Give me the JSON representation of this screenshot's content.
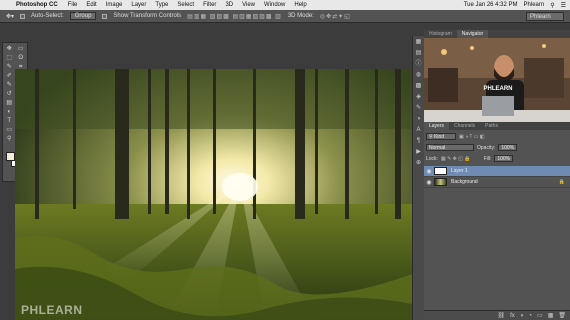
{
  "menubar": {
    "apple": "",
    "app_name": "Photoshop CC",
    "items": [
      "File",
      "Edit",
      "Image",
      "Layer",
      "Type",
      "Select",
      "Filter",
      "3D",
      "View",
      "Window",
      "Help"
    ],
    "datetime": "Tue Jan 26  4:32 PM",
    "user": "Phlearn"
  },
  "options_bar": {
    "auto_select_label": "Auto-Select:",
    "auto_select_value": "Group",
    "transform_label": "Show Transform Controls",
    "mode_label": "3D Mode:",
    "workspace": "Phlearn"
  },
  "toolbar": {
    "tools": [
      "move-tool",
      "artboard-tool",
      "marquee-tool",
      "lasso-tool",
      "quick-select-tool",
      "crop-tool",
      "eyedropper-tool",
      "healing-tool",
      "brush-tool",
      "clone-tool",
      "history-brush-tool",
      "eraser-tool",
      "gradient-tool",
      "blur-tool",
      "dodge-tool",
      "pen-tool",
      "type-tool",
      "path-select-tool",
      "shape-tool",
      "hand-tool",
      "zoom-tool"
    ],
    "glyphs": [
      "✥",
      "▭",
      "⬚",
      "ʘ",
      "✎",
      "⌗",
      "✐",
      "✚",
      "✎",
      "⛁",
      "↺",
      "◻",
      "▤",
      "◉",
      "◐",
      "✒",
      "T",
      "➤",
      "▭",
      "✋",
      "⚲"
    ]
  },
  "navigator": {
    "tabs": [
      "Histogram",
      "Navigator"
    ],
    "active_tab": "Navigator",
    "laptop_text": "PHLEARN"
  },
  "layers": {
    "tabs": [
      "Layers",
      "Channels",
      "Paths"
    ],
    "kind_label": "Kind",
    "blend_mode": "Normal",
    "opacity_label": "Opacity:",
    "opacity_value": "100%",
    "lock_label": "Lock:",
    "fill_label": "Fill:",
    "fill_value": "100%",
    "items": [
      {
        "name": "Layer 1",
        "selected": true
      },
      {
        "name": "Background",
        "selected": false
      }
    ],
    "bottom_icons": [
      "⛓",
      "fx",
      "◑",
      "◔",
      "▭",
      "▦",
      "🗑"
    ]
  },
  "watermark": "PHLEARN",
  "colors": {
    "interface_dark": "#535353",
    "selection": "#6f8ab3",
    "foreground_swatch": "#f4ecd6",
    "background_swatch": "#ffffff"
  }
}
